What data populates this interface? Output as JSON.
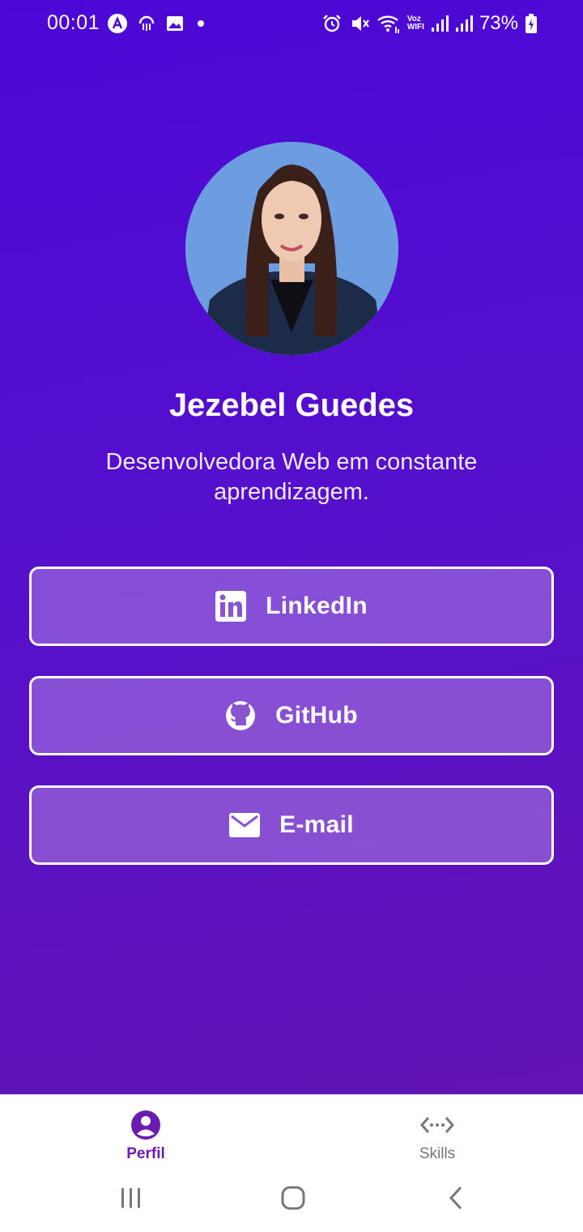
{
  "status_bar": {
    "time": "00:01",
    "battery_percent": "73%",
    "left_icons": [
      "app-a-icon",
      "cloud-sync-icon",
      "gallery-icon",
      "dot-icon"
    ],
    "right_icons": [
      "alarm-icon",
      "mute-icon",
      "wifi-icon",
      "vowifi-icon",
      "signal-icon",
      "signal-icon",
      "battery-charging-icon"
    ],
    "vowifi_label_top": "Voz",
    "vowifi_label_bottom": "WIFI"
  },
  "profile": {
    "name": "Jezebel Guedes",
    "bio": "Desenvolvedora Web em constante aprendizagem.",
    "avatar_bg": "#6c9de0"
  },
  "links": [
    {
      "label": "LinkedIn",
      "icon": "linkedin-icon"
    },
    {
      "label": "GitHub",
      "icon": "github-icon"
    },
    {
      "label": "E-mail",
      "icon": "mail-icon"
    }
  ],
  "tabs": [
    {
      "label": "Perfil",
      "icon": "person-circle-icon",
      "active": true
    },
    {
      "label": "Skills",
      "icon": "code-brackets-icon",
      "active": false
    }
  ],
  "colors": {
    "gradient_top": "#4c07d6",
    "gradient_bottom": "#6214b4",
    "active_tab": "#6a1bb0",
    "inactive_tab": "#777777"
  }
}
